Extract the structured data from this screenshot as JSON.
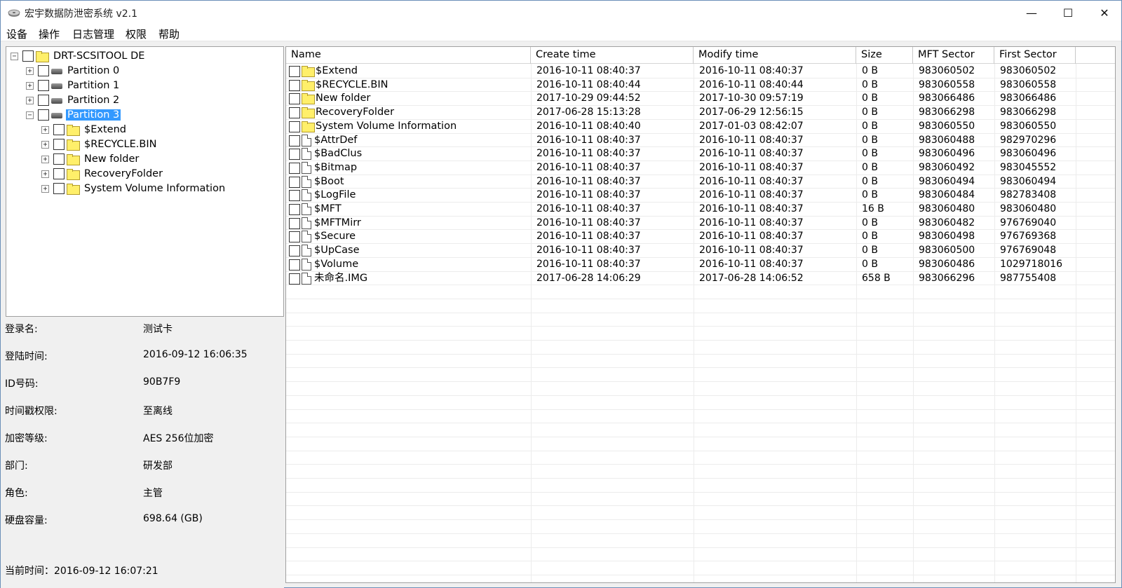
{
  "window": {
    "title": "宏宇数据防泄密系统 v2.1",
    "controls": {
      "minimize": "—",
      "maximize": "☐",
      "close": "✕"
    }
  },
  "menu": [
    "设备",
    "操作",
    "日志管理",
    "权限",
    "帮助"
  ],
  "tree": {
    "root": {
      "label": "DRT-SCSITOOL DE",
      "expander": "−"
    },
    "partitions": [
      {
        "label": "Partition 0",
        "expander": "+"
      },
      {
        "label": "Partition 1",
        "expander": "+"
      },
      {
        "label": "Partition 2",
        "expander": "+"
      },
      {
        "label": "Partition 3",
        "expander": "−",
        "selected": true
      }
    ],
    "children": [
      {
        "label": "$Extend",
        "expander": "+"
      },
      {
        "label": "$RECYCLE.BIN",
        "expander": "+"
      },
      {
        "label": "New folder",
        "expander": "+"
      },
      {
        "label": "RecoveryFolder",
        "expander": "+"
      },
      {
        "label": "System Volume Information",
        "expander": "+"
      }
    ]
  },
  "info": [
    {
      "label": "登录名:",
      "value": "测试卡"
    },
    {
      "label": "登陆时间:",
      "value": "2016-09-12  16:06:35"
    },
    {
      "label": "ID号码:",
      "value": "90B7F9"
    },
    {
      "label": "时间戳权限:",
      "value": "至离线"
    },
    {
      "label": "加密等级:",
      "value": "AES 256位加密"
    },
    {
      "label": "部门:",
      "value": "研发部"
    },
    {
      "label": "角色:",
      "value": "主管"
    },
    {
      "label": "硬盘容量:",
      "value": "698.64 (GB)"
    }
  ],
  "current_time": "当前时间：2016-09-12 16:07:21",
  "columns": [
    "Name",
    "Create time",
    "Modify time",
    "Size",
    "MFT Sector",
    "First Sector"
  ],
  "files": [
    {
      "type": "folder",
      "name": "$Extend",
      "create": "2016-10-11  08:40:37",
      "modify": "2016-10-11  08:40:37",
      "size": "0 B",
      "mft": "983060502",
      "first": "983060502"
    },
    {
      "type": "folder",
      "name": "$RECYCLE.BIN",
      "create": "2016-10-11  08:40:44",
      "modify": "2016-10-11  08:40:44",
      "size": "0 B",
      "mft": "983060558",
      "first": "983060558"
    },
    {
      "type": "folder",
      "name": "New folder",
      "create": "2017-10-29  09:44:52",
      "modify": "2017-10-30  09:57:19",
      "size": "0 B",
      "mft": "983066486",
      "first": "983066486"
    },
    {
      "type": "folder",
      "name": "RecoveryFolder",
      "create": "2017-06-28  15:13:28",
      "modify": "2017-06-29  12:56:15",
      "size": "0 B",
      "mft": "983066298",
      "first": "983066298"
    },
    {
      "type": "folder",
      "name": "System Volume Information",
      "create": "2016-10-11  08:40:40",
      "modify": "2017-01-03  08:42:07",
      "size": "0 B",
      "mft": "983060550",
      "first": "983060550"
    },
    {
      "type": "file",
      "name": "$AttrDef",
      "create": "2016-10-11  08:40:37",
      "modify": "2016-10-11  08:40:37",
      "size": "0 B",
      "mft": "983060488",
      "first": "982970296"
    },
    {
      "type": "file",
      "name": "$BadClus",
      "create": "2016-10-11  08:40:37",
      "modify": "2016-10-11  08:40:37",
      "size": "0 B",
      "mft": "983060496",
      "first": "983060496"
    },
    {
      "type": "file",
      "name": "$Bitmap",
      "create": "2016-10-11  08:40:37",
      "modify": "2016-10-11  08:40:37",
      "size": "0 B",
      "mft": "983060492",
      "first": "983045552"
    },
    {
      "type": "file",
      "name": "$Boot",
      "create": "2016-10-11  08:40:37",
      "modify": "2016-10-11  08:40:37",
      "size": "0 B",
      "mft": "983060494",
      "first": "983060494"
    },
    {
      "type": "file",
      "name": "$LogFile",
      "create": "2016-10-11  08:40:37",
      "modify": "2016-10-11  08:40:37",
      "size": "0 B",
      "mft": "983060484",
      "first": "982783408"
    },
    {
      "type": "file",
      "name": "$MFT",
      "create": "2016-10-11  08:40:37",
      "modify": "2016-10-11  08:40:37",
      "size": "16 B",
      "mft": "983060480",
      "first": "983060480"
    },
    {
      "type": "file",
      "name": "$MFTMirr",
      "create": "2016-10-11  08:40:37",
      "modify": "2016-10-11  08:40:37",
      "size": "0 B",
      "mft": "983060482",
      "first": "976769040"
    },
    {
      "type": "file",
      "name": "$Secure",
      "create": "2016-10-11  08:40:37",
      "modify": "2016-10-11  08:40:37",
      "size": "0 B",
      "mft": "983060498",
      "first": "976769368"
    },
    {
      "type": "file",
      "name": "$UpCase",
      "create": "2016-10-11  08:40:37",
      "modify": "2016-10-11  08:40:37",
      "size": "0 B",
      "mft": "983060500",
      "first": "976769048"
    },
    {
      "type": "file",
      "name": "$Volume",
      "create": "2016-10-11  08:40:37",
      "modify": "2016-10-11  08:40:37",
      "size": "0 B",
      "mft": "983060486",
      "first": "1029718016"
    },
    {
      "type": "file",
      "name": "未命名.IMG",
      "create": "2017-06-28  14:06:29",
      "modify": "2017-06-28  14:06:52",
      "size": "658 B",
      "mft": "983066296",
      "first": "987755408"
    }
  ]
}
